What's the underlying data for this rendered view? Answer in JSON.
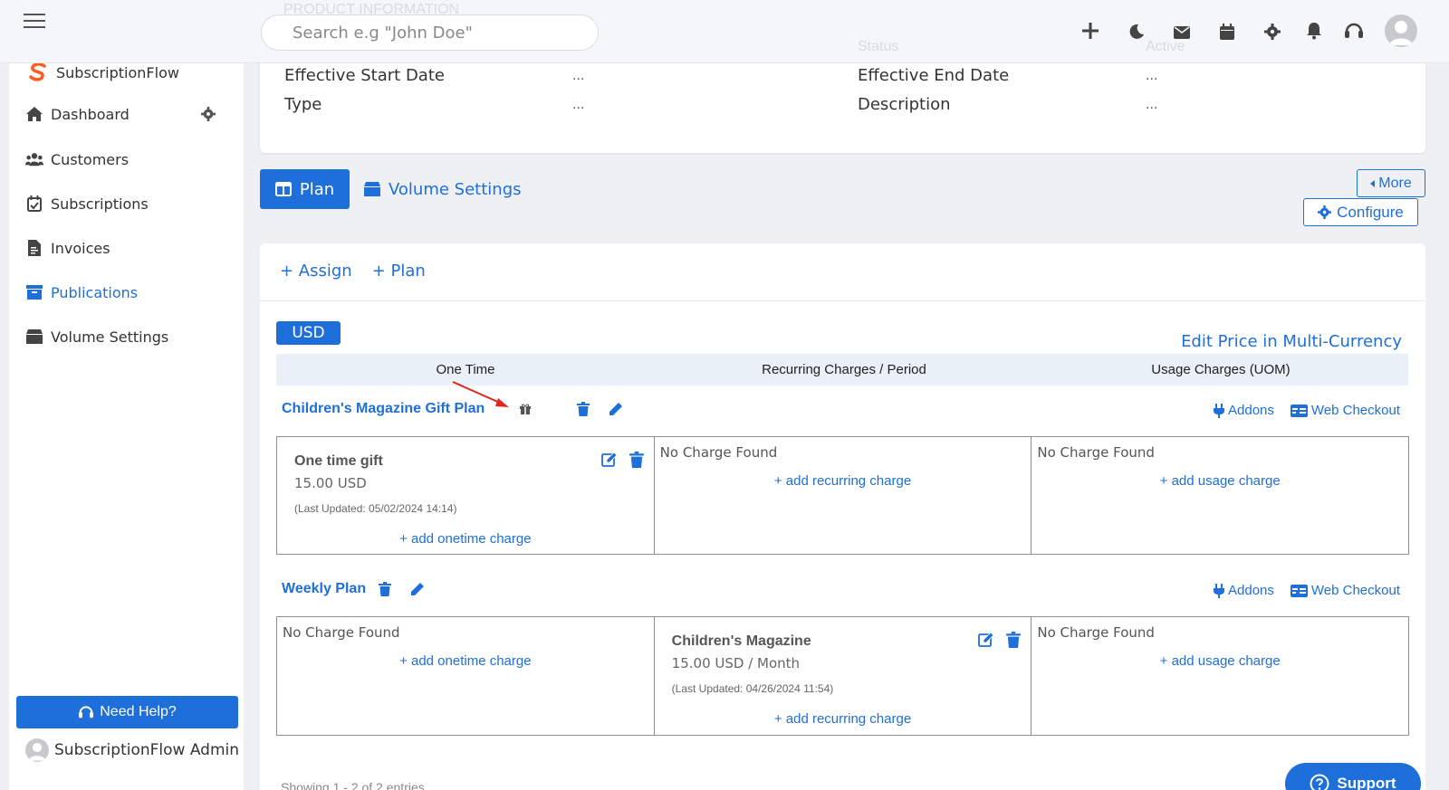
{
  "topbar": {
    "search_placeholder": "Search e.g \"John Doe\"",
    "ghost_section_title": "PRODUCT INFORMATION",
    "ghost_status_label": "Status",
    "ghost_status_value": "Active"
  },
  "sidebar": {
    "brand": "SubscriptionFlow",
    "items": [
      {
        "label": "Dashboard",
        "icon": "home-icon"
      },
      {
        "label": "Customers",
        "icon": "users-icon"
      },
      {
        "label": "Subscriptions",
        "icon": "calendar-check-icon"
      },
      {
        "label": "Invoices",
        "icon": "invoice-icon"
      },
      {
        "label": "Publications",
        "icon": "archive-icon",
        "active": true
      },
      {
        "label": "Volume Settings",
        "icon": "box-icon"
      }
    ],
    "need_help": "Need Help?",
    "admin_name": "SubscriptionFlow Admin"
  },
  "info": {
    "effective_start_label": "Effective Start Date",
    "effective_start_value": "...",
    "effective_end_label": "Effective End Date",
    "effective_end_value": "...",
    "type_label": "Type",
    "type_value": "...",
    "description_label": "Description",
    "description_value": "..."
  },
  "tabs": {
    "plan": "Plan",
    "volume_settings": "Volume Settings",
    "more": "More",
    "configure": "Configure"
  },
  "card": {
    "assign": "+ Assign",
    "add_plan": "+ Plan",
    "currency": "USD",
    "edit_multi_currency": "Edit Price in Multi-Currency",
    "columns": [
      "One Time",
      "Recurring Charges / Period",
      "Usage Charges (UOM)"
    ]
  },
  "plans": [
    {
      "name": "Children's Magazine Gift Plan",
      "addons": "Addons",
      "web_checkout": "Web Checkout",
      "onetime": {
        "title": "One time gift",
        "price": "15.00 USD",
        "updated": "(Last Updated: 05/02/2024 14:14)",
        "add": "+ add onetime charge"
      },
      "recurring": {
        "no_charge": "No Charge Found",
        "add": "+ add recurring charge"
      },
      "usage": {
        "no_charge": "No Charge Found",
        "add": "+ add usage charge"
      }
    },
    {
      "name": "Weekly Plan",
      "addons": "Addons",
      "web_checkout": "Web Checkout",
      "onetime": {
        "no_charge": "No Charge Found",
        "add": "+ add onetime charge"
      },
      "recurring": {
        "title": "Children's Magazine",
        "price": "15.00 USD / Month",
        "updated": "(Last Updated: 04/26/2024 11:54)",
        "add": "+ add recurring charge"
      },
      "usage": {
        "no_charge": "No Charge Found",
        "add": "+ add usage charge"
      }
    }
  ],
  "footer": {
    "showing": "Showing 1 - 2 of 2 entries",
    "support": "Support"
  },
  "colors": {
    "accent": "#1e6fd9",
    "annotation_arrow": "#e0261c",
    "background": "#eef0f3"
  }
}
